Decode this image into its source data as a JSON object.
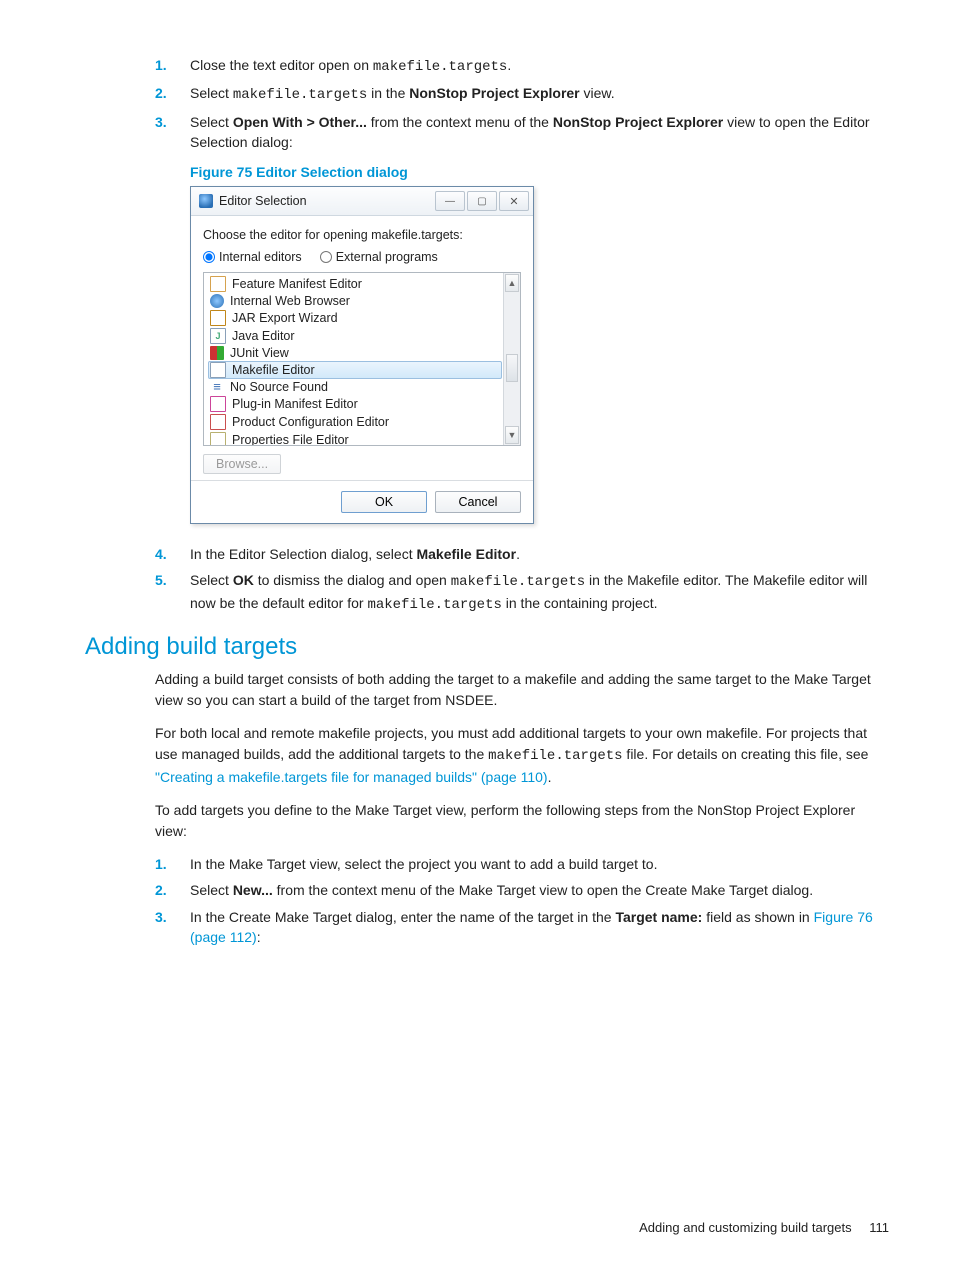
{
  "steps_a": {
    "s1_a": "Close the text editor open on ",
    "s1_code": "makefile.targets",
    "s1_b": ".",
    "s2_a": "Select ",
    "s2_code": "makefile.targets",
    "s2_b": " in the ",
    "s2_bold": "NonStop Project Explorer",
    "s2_c": " view.",
    "s3_a": "Select ",
    "s3_bold1": "Open With > Other...",
    "s3_b": " from the context menu of the ",
    "s3_bold2": "NonStop Project Explorer",
    "s3_c": " view to open the Editor Selection dialog:"
  },
  "figure_caption": "Figure 75 Editor Selection dialog",
  "dialog": {
    "title": "Editor Selection",
    "instr": "Choose the editor for opening makefile.targets:",
    "radio_internal": "Internal editors",
    "radio_external": "External programs",
    "items": {
      "i0": "Feature Manifest Editor",
      "i1": "Internal Web Browser",
      "i2": "JAR Export Wizard",
      "i3": "Java Editor",
      "i4": "JUnit View",
      "i5": "Makefile Editor",
      "i6": "No Source Found",
      "i7": "Plug-in Manifest Editor",
      "i8": "Product Configuration Editor",
      "i9": "Properties File Editor"
    },
    "browse": "Browse...",
    "ok": "OK",
    "cancel": "Cancel"
  },
  "steps_b": {
    "s4_a": "In the Editor Selection dialog, select ",
    "s4_bold": "Makefile Editor",
    "s4_b": ".",
    "s5_a": "Select ",
    "s5_bold": "OK",
    "s5_b": " to dismiss the dialog and open ",
    "s5_code1": "makefile.targets",
    "s5_c": " in the Makefile editor. The Makefile editor will now be the default editor for ",
    "s5_code2": "makefile.targets",
    "s5_d": " in the containing project."
  },
  "section_heading": "Adding build targets",
  "para1": "Adding a build target consists of both adding the target to a makefile and adding the same target to the Make Target view so you can start a build of the target from NSDEE.",
  "para2": {
    "a": "For both local and remote makefile projects, you must add additional targets to your own makefile. For projects that use managed builds, add the additional targets to the ",
    "code": "makefile.targets",
    "b": " file. For details on creating this file, see ",
    "link": "\"Creating a makefile.targets file for managed builds\" (page 110)",
    "c": "."
  },
  "para3": "To add targets you define to the Make Target view, perform the following steps from the NonStop Project Explorer view:",
  "steps_c": {
    "s1": "In the Make Target view, select the project you want to add a build target to.",
    "s2_a": "Select ",
    "s2_bold": "New...",
    "s2_b": " from the context menu of the Make Target view to open the Create Make Target dialog.",
    "s3_a": "In the Create Make Target dialog, enter the name of the target in the ",
    "s3_bold": "Target name:",
    "s3_b": " field as shown in ",
    "s3_link": "Figure 76 (page 112)",
    "s3_c": ":"
  },
  "footer_text": "Adding and customizing build targets",
  "page_number": "111"
}
